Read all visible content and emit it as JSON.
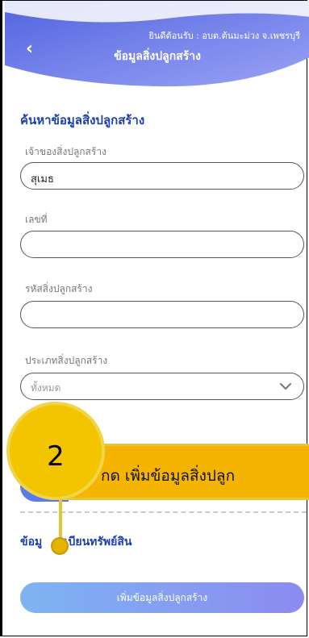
{
  "header": {
    "welcome": "ยินดีต้อนรับ : อบต.ต้นมะม่วง จ.เพชรบุรี",
    "back_icon": "chevron-left-icon",
    "title": "ข้อมูลสิ่งปลูกสร้าง"
  },
  "search": {
    "title": "ค้นหาข้อมูลสิ่งปลูกสร้าง",
    "owner_label": "เจ้าของสิ่งปลูกสร้าง",
    "owner_value": "สุเมธ",
    "number_label": "เลขที่",
    "number_value": "",
    "code_label": "รหัสสิ่งปลูกสร้าง",
    "code_value": "",
    "type_label": "ประเภทสิ่งปลูกสร้าง",
    "type_selected": "ทั้งหมด"
  },
  "register": {
    "title_left": "ข้อมู",
    "title_right": "ะเบียนทรัพย์สิน",
    "add_button": "เพิ่มข้อมูลสิ่งปลูกสร้าง"
  },
  "callout": {
    "step": "2",
    "text": "กด เพิ่มข้อมูลสิ่งปลูก"
  },
  "colors": {
    "header_top": "#5a6fe6",
    "header_bottom": "#8a93f0",
    "accent": "#1c3fae",
    "callout": "#f5b400"
  }
}
